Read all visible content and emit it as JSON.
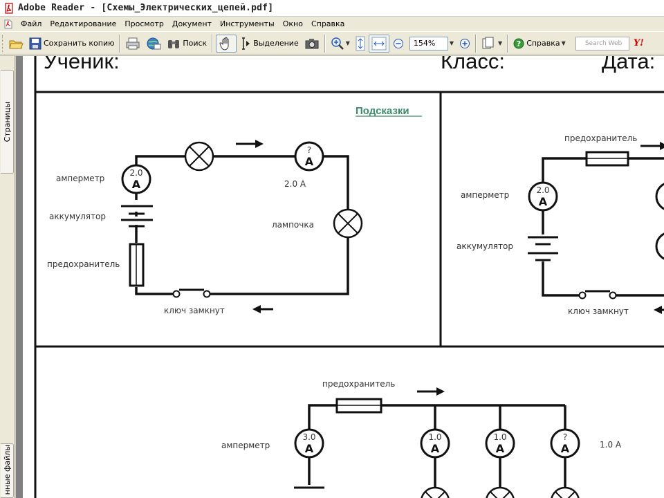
{
  "window": {
    "title": "Adobe Reader - [Схемы_Электрических_цепей.pdf]"
  },
  "menu": [
    "Файл",
    "Редактирование",
    "Просмотр",
    "Документ",
    "Инструменты",
    "Окно",
    "Справка"
  ],
  "toolbar": {
    "save_copy": "Сохранить копию",
    "search": "Поиск",
    "select": "Выделение",
    "zoom": "154%",
    "help": "Справка",
    "search_web_placeholder": "Search Web",
    "yahoo": "Y!"
  },
  "sidebar": {
    "pages_tab": "Страницы",
    "files_tab": "нные файлы"
  },
  "document": {
    "header": {
      "student": "Ученик:",
      "class": "Класс:",
      "date": "Дата:"
    },
    "hint": "Подсказки",
    "circuit1": {
      "ammeter_label": "амперметр",
      "ammeter_value": "2.0",
      "ammeter2_value": "?",
      "ammeter_symbol": "A",
      "current_value": "2.0 A",
      "battery_label": "аккумулятор",
      "fuse_label": "предохранитель",
      "lamp_label": "лампочка",
      "switch_label": "ключ замкнут"
    },
    "circuit2": {
      "fuse_label": "предохранитель",
      "ammeter_label": "амперметр",
      "ammeter_value": "2.0",
      "ammeter_symbol": "A",
      "battery_label": "аккумулятор",
      "switch_label": "ключ замкнут"
    },
    "circuit3": {
      "fuse_label": "предохранитель",
      "ammeter_label": "амперметр",
      "ammeter_symbol": "A",
      "meters": [
        "3.0",
        "1.0",
        "1.0",
        "?"
      ],
      "current_value": "1.0 A"
    }
  }
}
